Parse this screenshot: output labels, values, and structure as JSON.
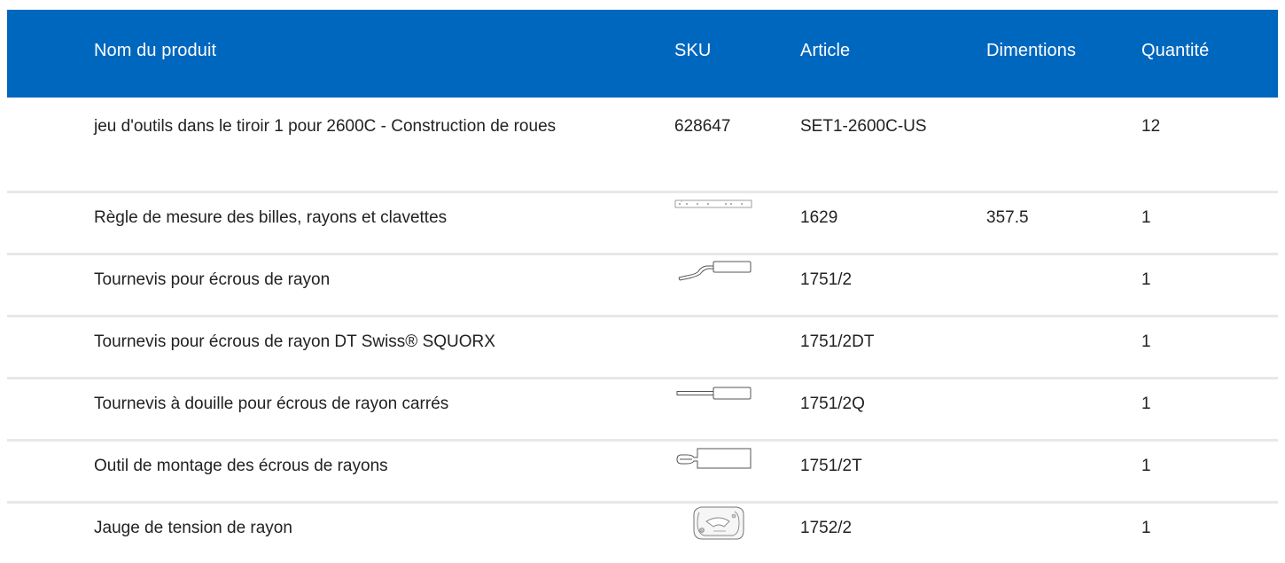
{
  "table": {
    "headers": {
      "name": "Nom du produit",
      "sku": "SKU",
      "article": "Article",
      "dimensions": "Dimentions",
      "quantity": "Quantité"
    },
    "rows": [
      {
        "name": "jeu d'outils dans le tiroir 1 pour 2600C - Construction de roues",
        "sku": "628647",
        "article": "SET1-2600C-US",
        "dimensions": "",
        "quantity": "12",
        "thumbnail": ""
      },
      {
        "name": "Règle de mesure des billes, rayons et clavettes",
        "sku": "",
        "article": "1629",
        "dimensions": "357.5",
        "quantity": "1",
        "thumbnail": "ruler-icon"
      },
      {
        "name": "Tournevis pour écrous de rayon",
        "sku": "",
        "article": "1751/2",
        "dimensions": "",
        "quantity": "1",
        "thumbnail": "bent-screwdriver-icon"
      },
      {
        "name": "Tournevis pour écrous de rayon DT Swiss® SQUORX",
        "sku": "",
        "article": "1751/2DT",
        "dimensions": "",
        "quantity": "1",
        "thumbnail": ""
      },
      {
        "name": "Tournevis à douille pour écrous de rayon carrés",
        "sku": "",
        "article": "1751/2Q",
        "dimensions": "",
        "quantity": "1",
        "thumbnail": "socket-screwdriver-icon"
      },
      {
        "name": "Outil de montage des écrous de rayons",
        "sku": "",
        "article": "1751/2T",
        "dimensions": "",
        "quantity": "1",
        "thumbnail": "nipple-mounting-tool-icon"
      },
      {
        "name": "Jauge de tension de rayon",
        "sku": "",
        "article": "1752/2",
        "dimensions": "",
        "quantity": "1",
        "thumbnail": "tension-gauge-icon"
      }
    ]
  },
  "colors": {
    "header_background": "#0067be",
    "header_text": "#ffffff",
    "row_divider": "#e8e8e8",
    "body_text": "#222222"
  }
}
